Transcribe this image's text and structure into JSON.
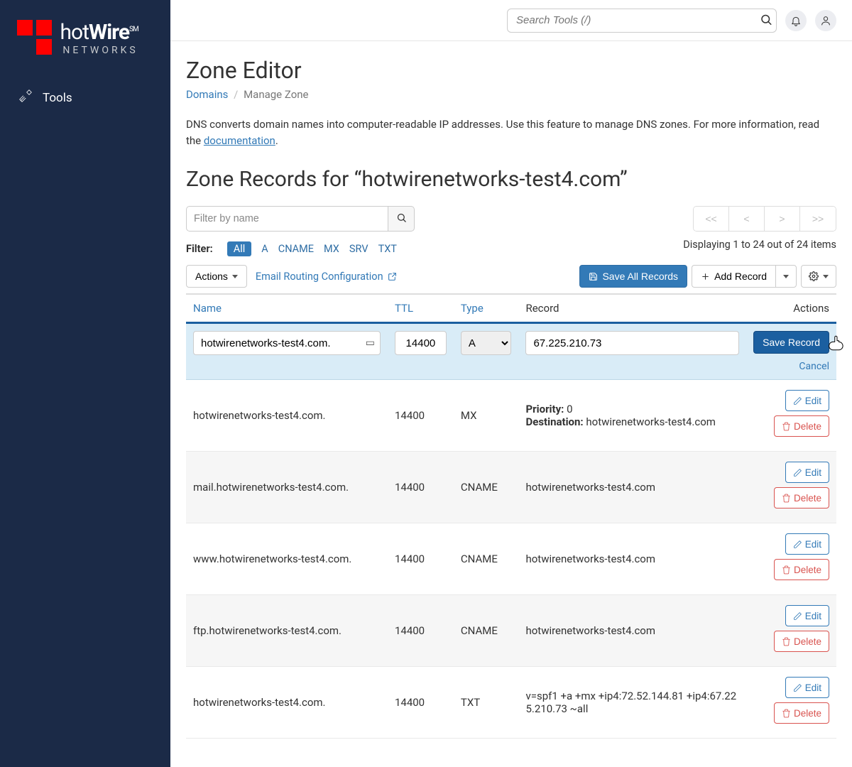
{
  "brand": {
    "name_main": "hot",
    "name_bold": "Wire",
    "mark": "SM",
    "sub": "NETWORKS"
  },
  "nav": {
    "tools": "Tools"
  },
  "topbar": {
    "search_placeholder": "Search Tools (/)"
  },
  "page": {
    "title": "Zone Editor",
    "crumb_domains": "Domains",
    "crumb_manage": "Manage Zone",
    "desc_pre": "DNS converts domain names into computer-readable IP addresses. Use this feature to manage DNS zones. For more information, read the ",
    "desc_link": "documentation",
    "desc_post": ".",
    "section_title": "Zone Records for “hotwirenetworks-test4.com”",
    "filter_placeholder": "Filter by name",
    "filter_label": "Filter:",
    "filters": [
      "All",
      "A",
      "CNAME",
      "MX",
      "SRV",
      "TXT"
    ],
    "pager": [
      "<<",
      "<",
      ">",
      ">>"
    ],
    "display_text": "Displaying 1 to 24 out of 24 items",
    "actions_label": "Actions",
    "email_routing": "Email Routing Configuration",
    "save_all": "Save All Records",
    "add_record": "Add Record",
    "table_headers": {
      "name": "Name",
      "ttl": "TTL",
      "type": "Type",
      "record": "Record",
      "actions": "Actions"
    },
    "edit_row": {
      "name": "hotwirenetworks-test4.com.",
      "ttl": "14400",
      "type": "A",
      "record": "67.225.210.73",
      "save": "Save Record",
      "cancel": "Cancel"
    },
    "labels": {
      "edit": "Edit",
      "delete": "Delete",
      "priority": "Priority:",
      "destination": "Destination:"
    },
    "rows": [
      {
        "name": "hotwirenetworks-test4.com.",
        "ttl": "14400",
        "type": "MX",
        "record": {
          "priority": "0",
          "destination": "hotwirenetworks-test4.com"
        }
      },
      {
        "name": "mail.hotwirenetworks-test4.com.",
        "ttl": "14400",
        "type": "CNAME",
        "record": "hotwirenetworks-test4.com"
      },
      {
        "name": "www.hotwirenetworks-test4.com.",
        "ttl": "14400",
        "type": "CNAME",
        "record": "hotwirenetworks-test4.com"
      },
      {
        "name": "ftp.hotwirenetworks-test4.com.",
        "ttl": "14400",
        "type": "CNAME",
        "record": "hotwirenetworks-test4.com"
      },
      {
        "name": "hotwirenetworks-test4.com.",
        "ttl": "14400",
        "type": "TXT",
        "record": "v=spf1 +a +mx +ip4:72.52.144.81 +ip4:67.225.210.73 ~all"
      }
    ]
  }
}
